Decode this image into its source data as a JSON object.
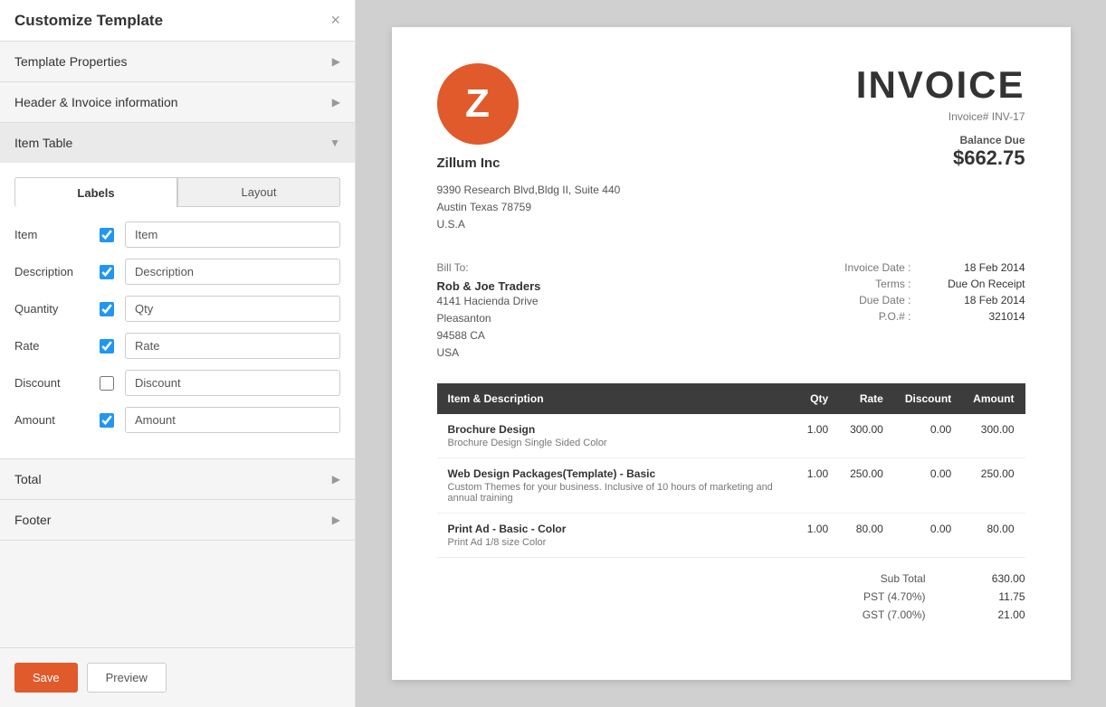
{
  "panel": {
    "title": "Customize Template",
    "close_label": "×",
    "sections": [
      {
        "id": "template-properties",
        "label": "Template Properties",
        "open": false
      },
      {
        "id": "header-invoice",
        "label": "Header & Invoice information",
        "open": false
      },
      {
        "id": "item-table",
        "label": "Item Table",
        "open": true
      },
      {
        "id": "total",
        "label": "Total",
        "open": false
      },
      {
        "id": "footer",
        "label": "Footer",
        "open": false
      }
    ],
    "tabs": [
      {
        "id": "labels",
        "label": "Labels",
        "active": true
      },
      {
        "id": "layout",
        "label": "Layout",
        "active": false
      }
    ],
    "fields": [
      {
        "id": "item",
        "label": "Item",
        "checked": true,
        "value": "Item"
      },
      {
        "id": "description",
        "label": "Description",
        "checked": true,
        "value": "Description"
      },
      {
        "id": "quantity",
        "label": "Quantity",
        "checked": true,
        "value": "Qty"
      },
      {
        "id": "rate",
        "label": "Rate",
        "checked": true,
        "value": "Rate"
      },
      {
        "id": "discount",
        "label": "Discount",
        "checked": false,
        "value": "Discount"
      },
      {
        "id": "amount",
        "label": "Amount",
        "checked": true,
        "value": "Amount"
      }
    ],
    "save_label": "Save",
    "preview_label": "Preview"
  },
  "invoice": {
    "logo_letter": "Z",
    "title": "INVOICE",
    "invoice_number_label": "Invoice# INV-17",
    "balance_due_label": "Balance Due",
    "balance_due_amount": "$662.75",
    "company": {
      "name": "Zillum Inc",
      "address_line1": "9390 Research Blvd,Bldg II, Suite 440",
      "address_line2": "Austin Texas 78759",
      "address_line3": "U.S.A"
    },
    "bill_to": {
      "label": "Bill To:",
      "name": "Rob & Joe Traders",
      "address_line1": "4141 Hacienda Drive",
      "address_line2": "Pleasanton",
      "address_line3": "94588 CA",
      "address_line4": "USA"
    },
    "details": [
      {
        "key": "Invoice Date :",
        "value": "18 Feb 2014"
      },
      {
        "key": "Terms :",
        "value": "Due On Receipt"
      },
      {
        "key": "Due Date :",
        "value": "18 Feb 2014"
      },
      {
        "key": "P.O.# :",
        "value": "321014"
      }
    ],
    "table": {
      "headers": [
        "Item & Description",
        "Qty",
        "Rate",
        "Discount",
        "Amount"
      ],
      "rows": [
        {
          "name": "Brochure Design",
          "desc": "Brochure Design Single Sided Color",
          "qty": "1.00",
          "rate": "300.00",
          "discount": "0.00",
          "amount": "300.00"
        },
        {
          "name": "Web Design Packages(Template) - Basic",
          "desc": "Custom Themes for your business. Inclusive of 10 hours of marketing and annual training",
          "qty": "1.00",
          "rate": "250.00",
          "discount": "0.00",
          "amount": "250.00"
        },
        {
          "name": "Print Ad - Basic - Color",
          "desc": "Print Ad 1/8 size Color",
          "qty": "1.00",
          "rate": "80.00",
          "discount": "0.00",
          "amount": "80.00"
        }
      ]
    },
    "totals": [
      {
        "key": "Sub Total",
        "value": "630.00"
      },
      {
        "key": "PST (4.70%)",
        "value": "11.75"
      },
      {
        "key": "GST (7.00%)",
        "value": "21.00"
      }
    ]
  }
}
